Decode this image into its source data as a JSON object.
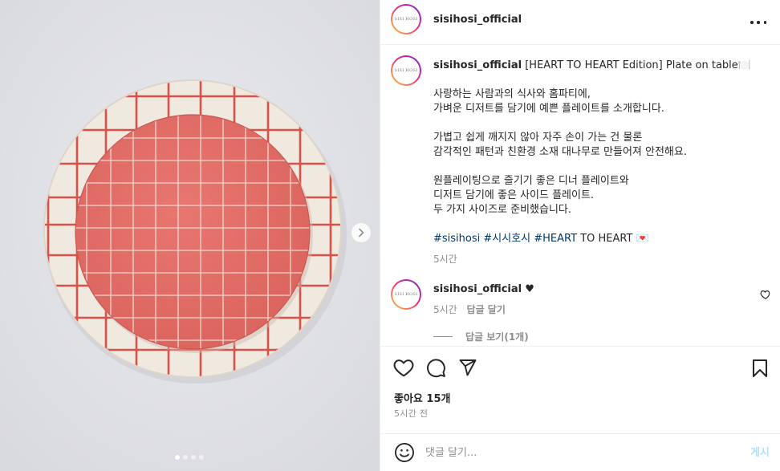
{
  "account": {
    "username": "sisihosi_official",
    "avatar_text": "SISI HOSI"
  },
  "header": {
    "more_icon": "more-horizontal-icon"
  },
  "media": {
    "current_slide": 1,
    "total_slides": 4,
    "next_icon": "chevron-right-icon",
    "colors": {
      "background": "#e2e3e7",
      "plate_outer": "#eee7dd",
      "plate_inner": "#e06a64",
      "grid_line": "#dd5148"
    }
  },
  "caption": {
    "username": "sisihosi_official",
    "title": " [HEART TO HEART Edition] Plate on table🍽️",
    "lines": [
      "사랑하는 사람과의 식사와 홈파티에,",
      "가벼운 디저트를 담기에 예쁜 플레이트를 소개합니다.",
      "",
      "가볍고 쉽게 깨지지 않아 자주 손이 가는 건 물론",
      "감각적인 패턴과 친환경 소재 대나무로 만들어져 안전해요.",
      "",
      "원플레이팅으로 즐기기 좋은 디너 플레이트와",
      "디저트 담기에 좋은 사이드 플레이트.",
      "두 가지 사이즈로 준비했습니다."
    ],
    "hashtags": [
      "#sisihosi",
      "#시시호시",
      "#HEART"
    ],
    "hashtag_tail": " TO HEART 💌",
    "time": "5시간"
  },
  "comment": {
    "username": "sisihosi_official",
    "text": " ♥",
    "time": "5시간",
    "reply_label": "답글 달기",
    "view_replies": "답글 보기(1개)",
    "like_icon": "heart-outline-icon"
  },
  "actions": {
    "like_icon": "heart-outline-icon",
    "comment_icon": "comment-bubble-icon",
    "share_icon": "paper-plane-icon",
    "save_icon": "bookmark-icon"
  },
  "likes": "좋아요 15개",
  "posted_time": "5시간 전",
  "add_comment": {
    "emoji_icon": "smiley-icon",
    "placeholder": "댓글 달기...",
    "post_label": "게시"
  }
}
